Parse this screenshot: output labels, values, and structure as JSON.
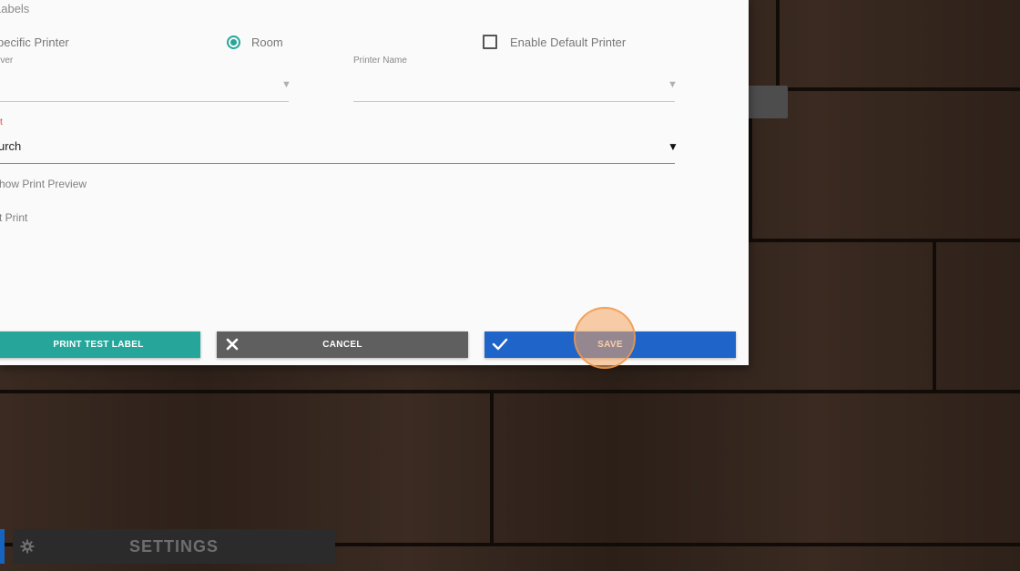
{
  "dialog": {
    "title": "Labels",
    "radio_specific": "pecific Printer",
    "radio_room": "Room",
    "checkbox_default": "Enable Default Printer",
    "server_label": "rver",
    "printer_name_label": "Printer Name",
    "red_label": "t",
    "selected_value": "urch",
    "option_preview": "how Print Preview",
    "option_print": "t Print"
  },
  "buttons": {
    "print_test": "PRINT TEST LABEL",
    "cancel": "CANCEL",
    "save": "SAVE"
  },
  "footer": {
    "settings": "SETTINGS"
  },
  "icons": {
    "close": "x-icon",
    "check": "check-icon",
    "gear": "gear-icon",
    "dropdown": "triangle-down"
  },
  "colors": {
    "teal": "#26a69a",
    "cancel_gray": "#5f5f5f",
    "save_blue": "#1f65c9",
    "error_red": "#e53935"
  }
}
